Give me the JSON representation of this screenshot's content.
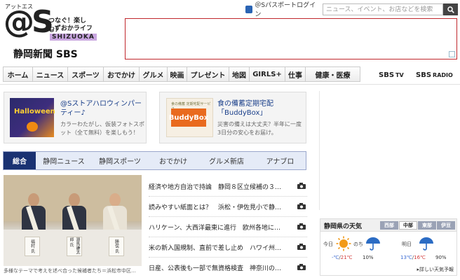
{
  "logo": {
    "mark": "@S",
    "kana": "アットエス",
    "tagline_1": "つなぐ！楽しむ！",
    "tagline_2": "しずおかライフ",
    "region": "SHIZUOKA",
    "paper": "静岡新聞 SBS"
  },
  "header": {
    "login_label": "＠Sパスポートログイン",
    "search_placeholder": "ニュース、イベント、お店などを検索"
  },
  "nav": {
    "items": [
      "ホーム",
      "ニュース",
      "スポーツ",
      "おでかけ",
      "グルメ",
      "映画",
      "プレゼント",
      "地図",
      "GIRLS+",
      "仕事",
      "健康・医療"
    ],
    "sbs_tv": "SBS",
    "sbs_tv_sub": "TV",
    "sbs_radio": "SBS",
    "sbs_radio_sub": "RADIO"
  },
  "promos": [
    {
      "title": "@Sストアハロウィンパーティー♪",
      "desc": "カラーわたがし、仮装フォトスポット（全て無料）を楽しもう！",
      "thumb_text": "Halloween"
    },
    {
      "title": "食の備蓄定期宅配「BuddyBox」",
      "desc": "災害の備えは大丈夫？半年に一度3日分の安心をお届け。",
      "thumb_sub": "食の備蓄 定期宅配サービス",
      "thumb_text": "BuddyBox"
    }
  ],
  "news_tabs": [
    "総合",
    "静岡ニュース",
    "静岡スポーツ",
    "おでかけ",
    "グルメ新店",
    "アナブロ"
  ],
  "main_photo": {
    "caption": "多様なテーマで考えを述べ合った候補者たち＝浜松市中区…",
    "plates": [
      "福村 氏",
      "源馬謙太郎 氏",
      "勝俣 氏"
    ]
  },
  "headlines": [
    "経済や地方自治で持論　静岡８区立候補の３…",
    "読みやすい紙面とは？　浜松・伊佐見小で静…",
    "ハリケーン、大西洋最東に進行　欧州各地に…",
    "米の新入国規制、直前で差し止め　ハワイ州…",
    "日産、公表後も一部で無資格検査　神奈川の…"
  ],
  "weather": {
    "title": "静岡県の天気",
    "regions": [
      "西部",
      "中部",
      "東部",
      "伊豆"
    ],
    "active_region": "中部",
    "today_label": "今日",
    "tomorrow_label": "明日",
    "later_label": "のち",
    "today_hi": "21℃",
    "today_lo": "-℃",
    "today_pct": "10%",
    "tomorrow_lo": "13℃",
    "tomorrow_hi": "16℃",
    "tomorrow_pct": "90%",
    "more_label": "詳しい天気予報",
    "colors": {
      "hi": "#d23a3a",
      "lo": "#3a6ad2",
      "sun": "#f29a18",
      "rain": "#2b6cc4"
    }
  }
}
